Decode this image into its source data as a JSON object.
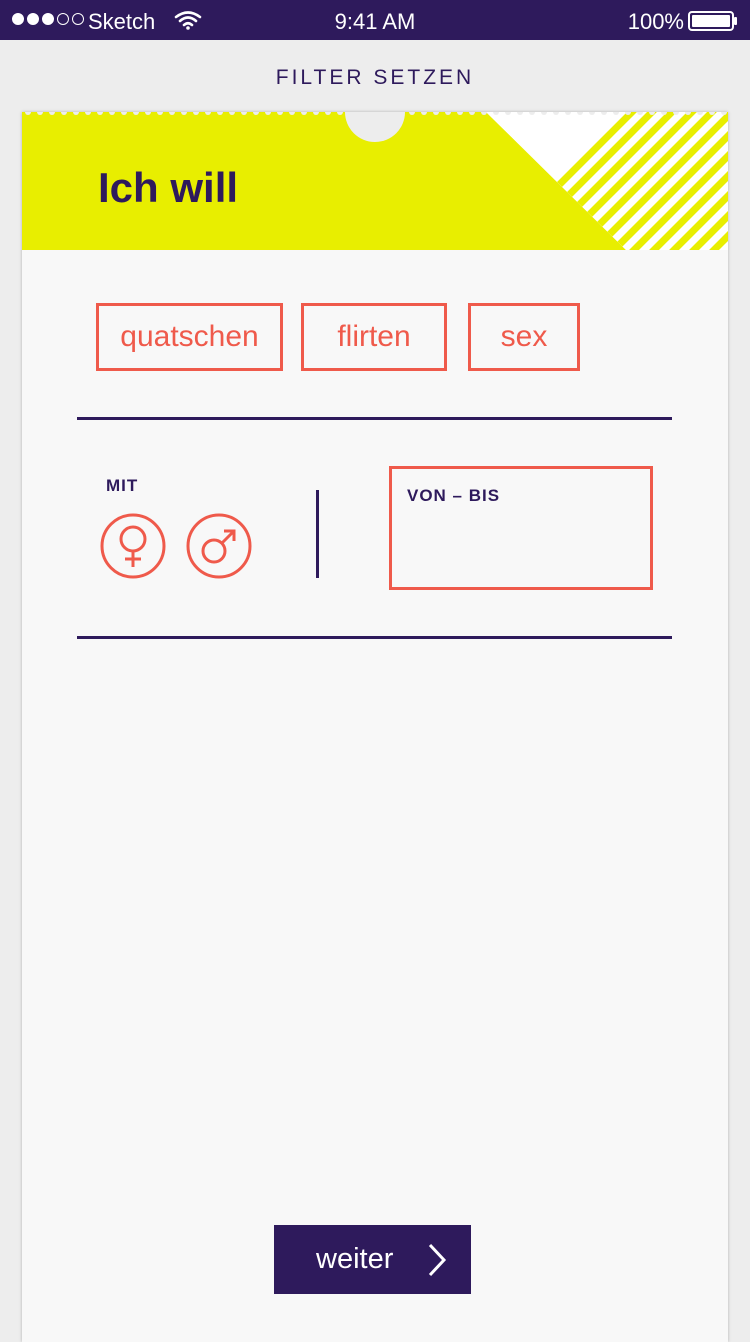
{
  "status_bar": {
    "carrier": "Sketch",
    "time": "9:41 AM",
    "battery": "100%",
    "signal_bars_filled": 3,
    "signal_bars_total": 5
  },
  "header": {
    "title": "FILTER SETZEN"
  },
  "card": {
    "title": "Ich will",
    "accent_color": "#e8ee00",
    "primary_color": "#2e1a5c",
    "option_color": "#ef5a4b",
    "options": [
      {
        "label": "quatschen"
      },
      {
        "label": "flirten"
      },
      {
        "label": "sex"
      }
    ],
    "with_label": "MIT",
    "genders": [
      {
        "name": "female",
        "icon": "female-symbol-icon"
      },
      {
        "name": "male",
        "icon": "male-symbol-icon"
      }
    ],
    "age_range_label": "VON – BIS"
  },
  "footer": {
    "next_label": "weiter",
    "next_icon": "chevron-right-icon"
  }
}
